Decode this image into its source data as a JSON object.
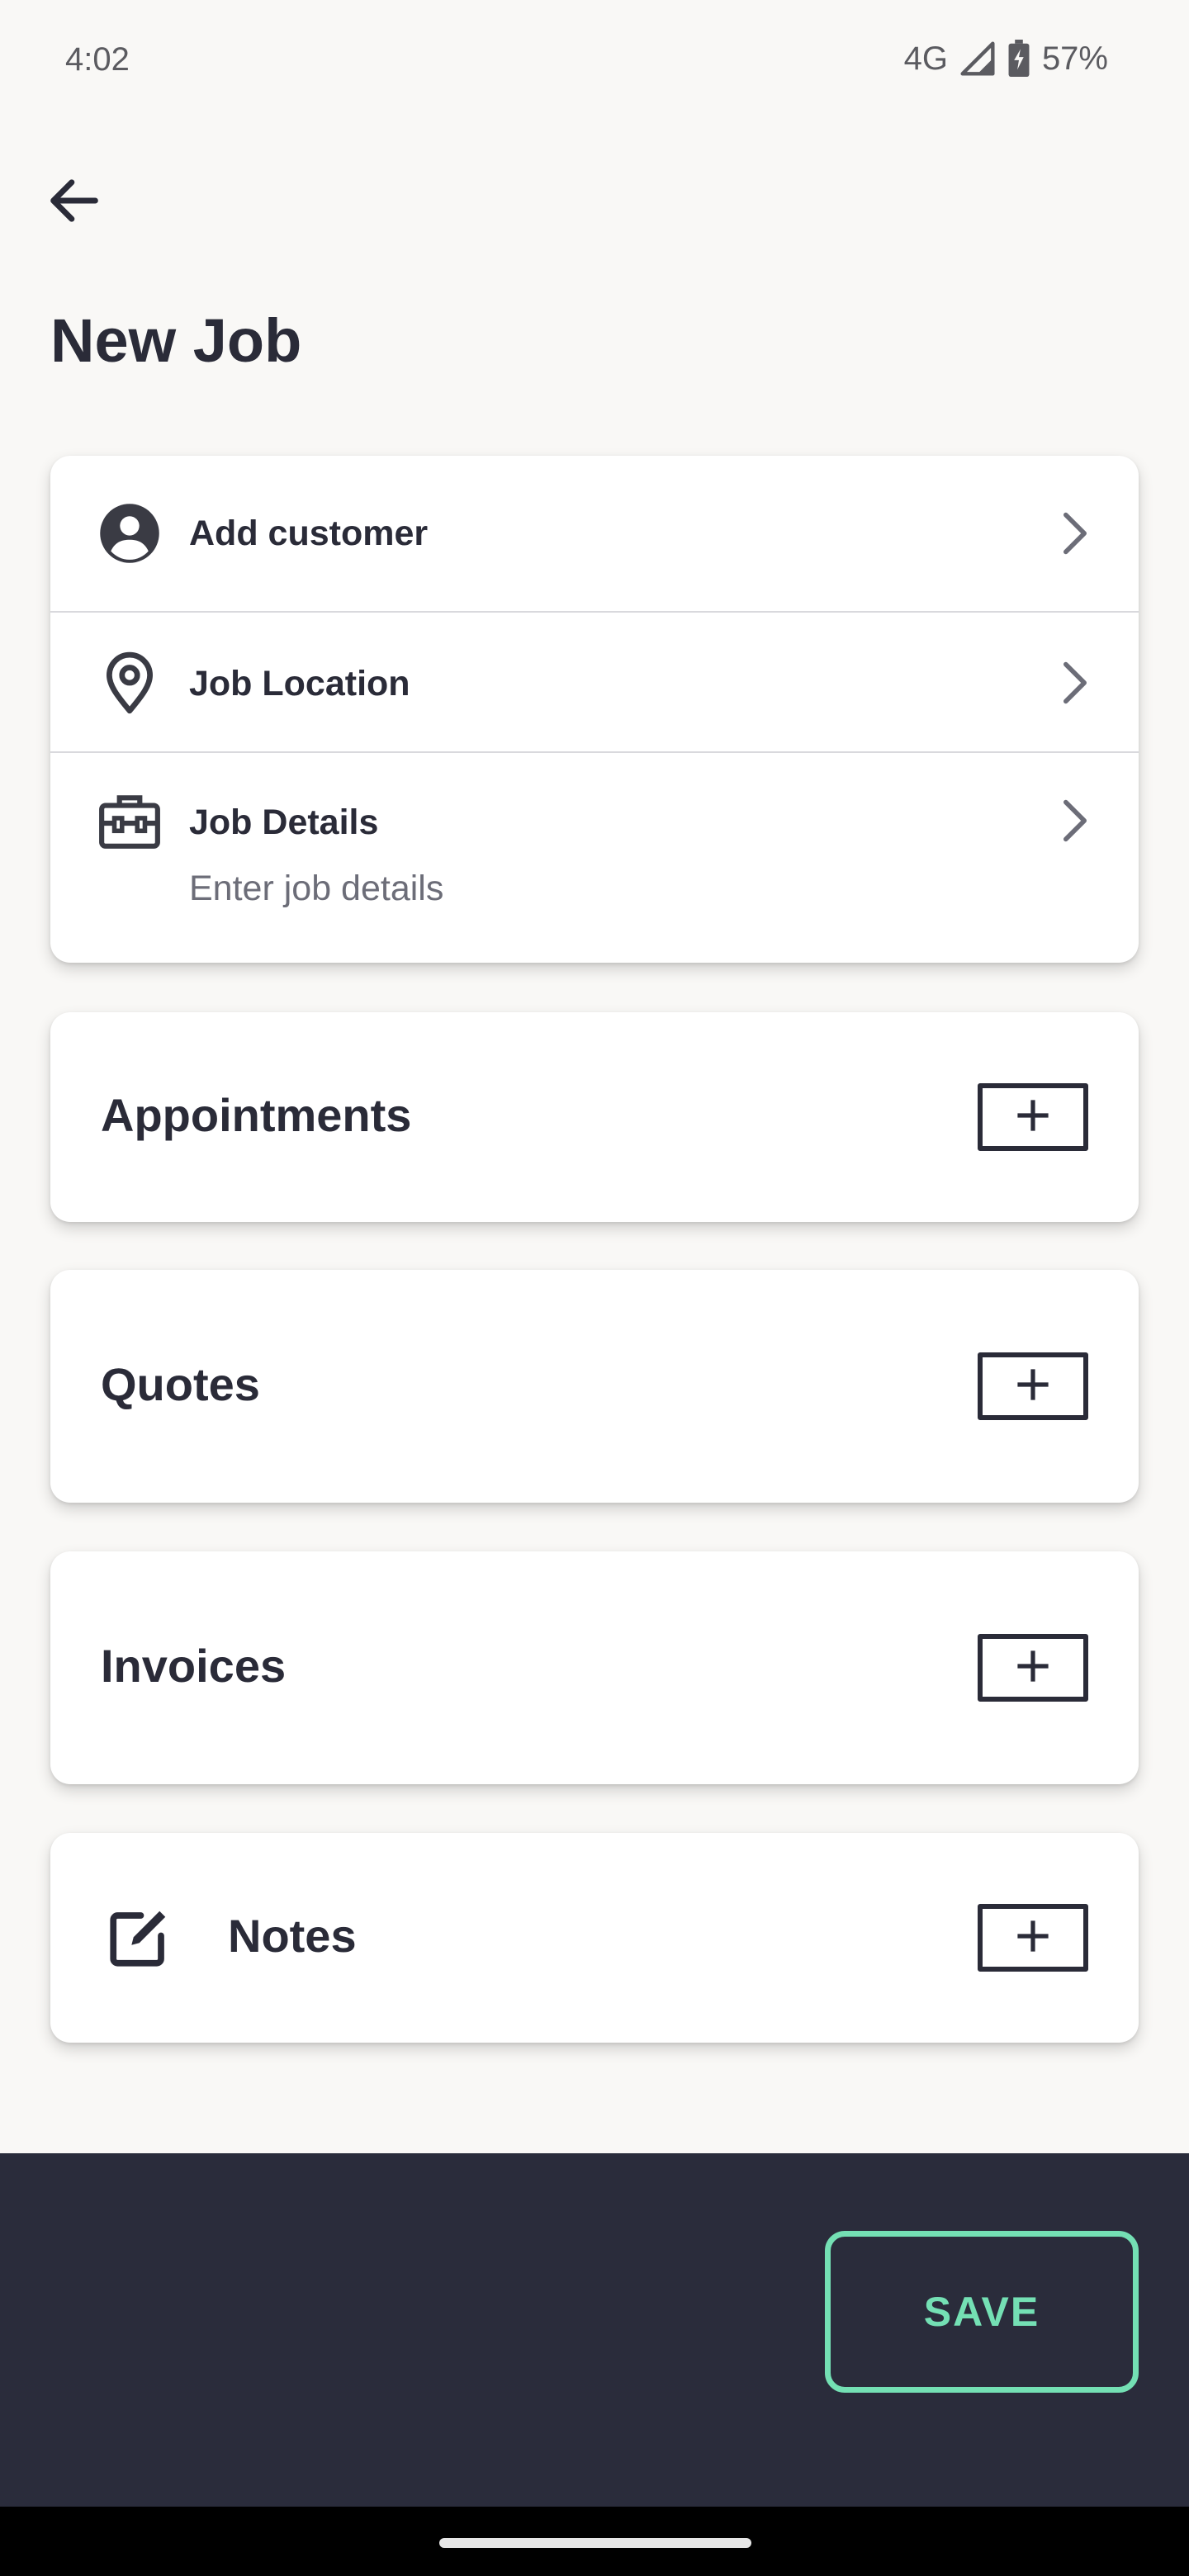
{
  "status_bar": {
    "time": "4:02",
    "network": "4G",
    "battery": "57%",
    "icons": [
      "signal-icon",
      "battery-charging-icon"
    ]
  },
  "app_bar": {
    "back_icon": "back-arrow-icon",
    "title": "New Job"
  },
  "details": {
    "rows": [
      {
        "icon": "person-icon",
        "label": "Add customer",
        "sub": ""
      },
      {
        "icon": "location-pin-icon",
        "label": "Job Location",
        "sub": ""
      },
      {
        "icon": "toolbox-icon",
        "label": "Job Details",
        "sub": "Enter job details"
      }
    ]
  },
  "sections": {
    "appointments": {
      "title": "Appointments",
      "add": "+"
    },
    "quotes": {
      "title": "Quotes",
      "add": "+"
    },
    "invoices": {
      "title": "Invoices",
      "add": "+"
    },
    "notes": {
      "title": "Notes",
      "add": "+",
      "icon": "edit-note-icon"
    }
  },
  "footer": {
    "save_label": "SAVE"
  },
  "colors": {
    "background": "#f9f8f6",
    "text_primary": "#2a2b38",
    "text_secondary": "#6c6d78",
    "bottom_bar": "#2a2c3b",
    "accent": "#74e0b4"
  }
}
